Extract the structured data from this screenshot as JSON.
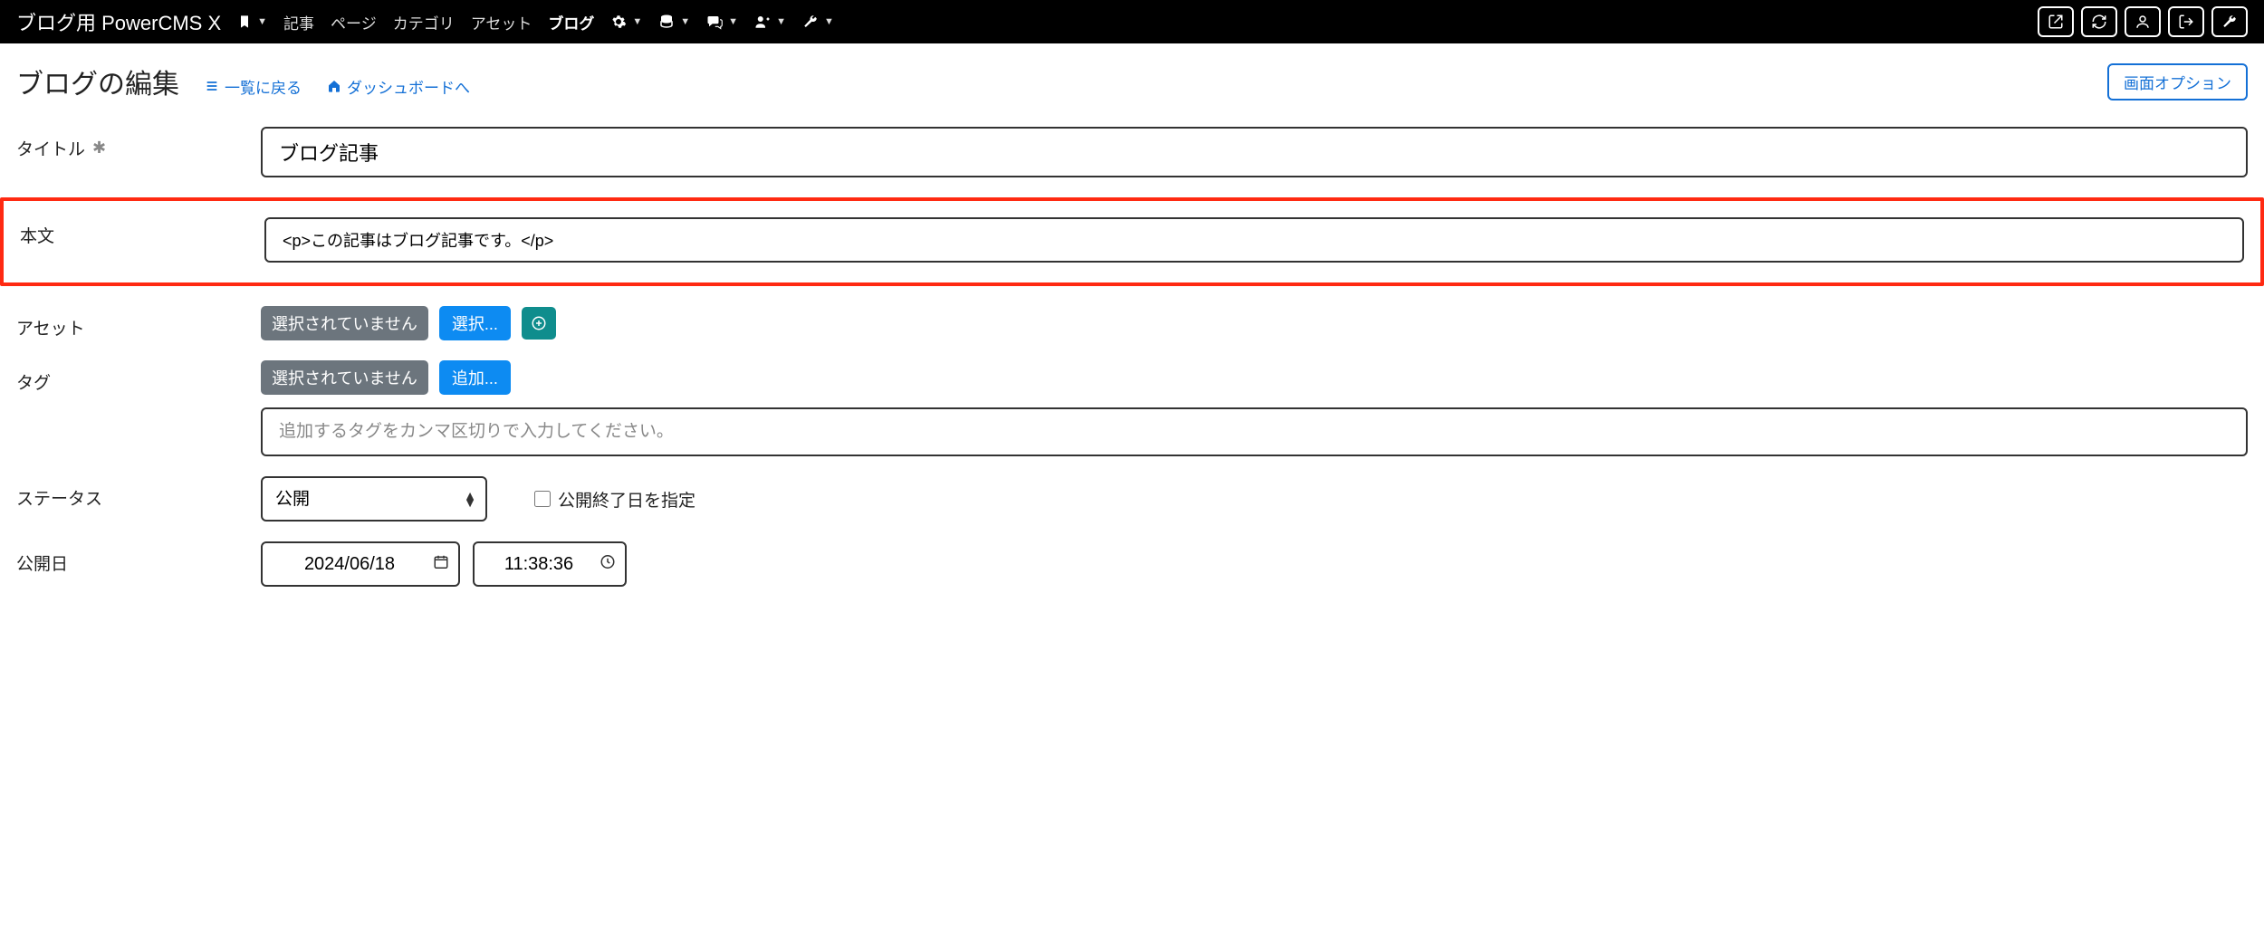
{
  "topbar": {
    "brand": "ブログ用 PowerCMS X",
    "nav": [
      {
        "label": "記事"
      },
      {
        "label": "ページ"
      },
      {
        "label": "カテゴリ"
      },
      {
        "label": "アセット"
      },
      {
        "label": "ブログ",
        "active": true
      }
    ]
  },
  "header": {
    "title": "ブログの編集",
    "back_to_list": "一覧に戻る",
    "dashboard": "ダッシュボードへ",
    "screen_options": "画面オプション"
  },
  "form": {
    "title_label": "タイトル",
    "title_value": "ブログ記事",
    "body_label": "本文",
    "body_value": "<p>この記事はブログ記事です。</p>",
    "asset_label": "アセット",
    "asset_none": "選択されていません",
    "asset_select": "選択...",
    "tag_label": "タグ",
    "tag_none": "選択されていません",
    "tag_add": "追加...",
    "tag_placeholder": "追加するタグをカンマ区切りで入力してください。",
    "status_label": "ステータス",
    "status_value": "公開",
    "end_date_checkbox": "公開終了日を指定",
    "publish_label": "公開日",
    "publish_date": "2024/06/18",
    "publish_time": "11:38:36"
  }
}
